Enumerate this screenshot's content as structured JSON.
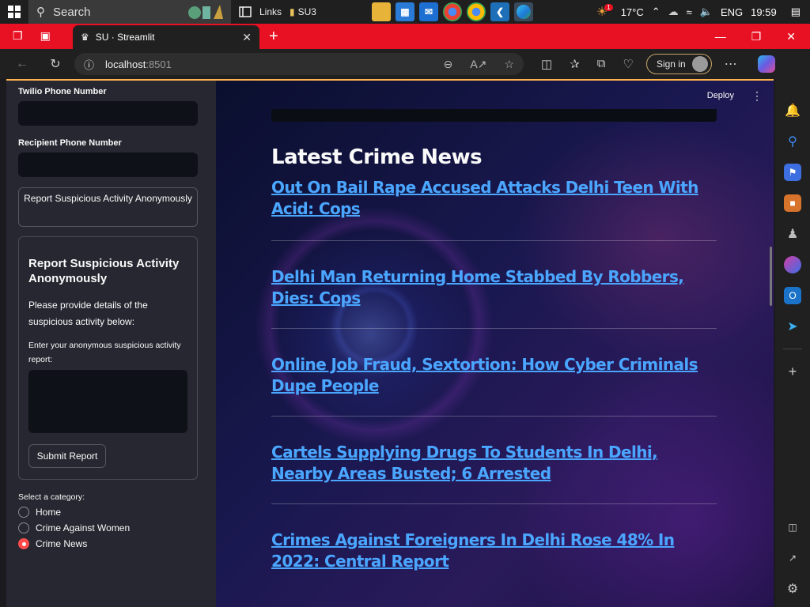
{
  "taskbar": {
    "search_placeholder": "Search",
    "links_label": "Links",
    "folder_label": "SU3",
    "weather": "17°C",
    "language": "ENG",
    "time": "19:59",
    "notification_count": "1"
  },
  "browser": {
    "tab_title": "SU · Streamlit",
    "url_host": "localhost",
    "url_port": ":8501",
    "sign_in": "Sign in"
  },
  "sidebar": {
    "twilio_label": "Twilio Phone Number",
    "recipient_label": "Recipient Phone Number",
    "report_button": "Report Suspicious Activity Anonymously",
    "form_title": "Report Suspicious Activity Anonymously",
    "form_desc": "Please provide details of the suspicious activity below:",
    "form_input_label": "Enter your anonymous suspicious activity report:",
    "submit": "Submit Report",
    "category_label": "Select a category:",
    "categories": [
      "Home",
      "Crime Against Women",
      "Crime News"
    ],
    "selected_category": "Crime News"
  },
  "header": {
    "deploy": "Deploy"
  },
  "main": {
    "title": "Latest Crime News",
    "news": [
      "Out On Bail Rape Accused Attacks Delhi Teen With Acid: Cops",
      "Delhi Man Returning Home Stabbed By Robbers, Dies: Cops",
      "Online Job Fraud, Sextortion: How Cyber Criminals Dupe People",
      "Cartels Supplying Drugs To Students In Delhi, Nearby Areas Busted; 6 Arrested",
      "Crimes Against Foreigners In Delhi Rose 48% In 2022: Central Report"
    ]
  },
  "colors": {
    "accent": "#ff4b4b",
    "link": "#4aa6ff",
    "tabbar": "#e81123"
  }
}
